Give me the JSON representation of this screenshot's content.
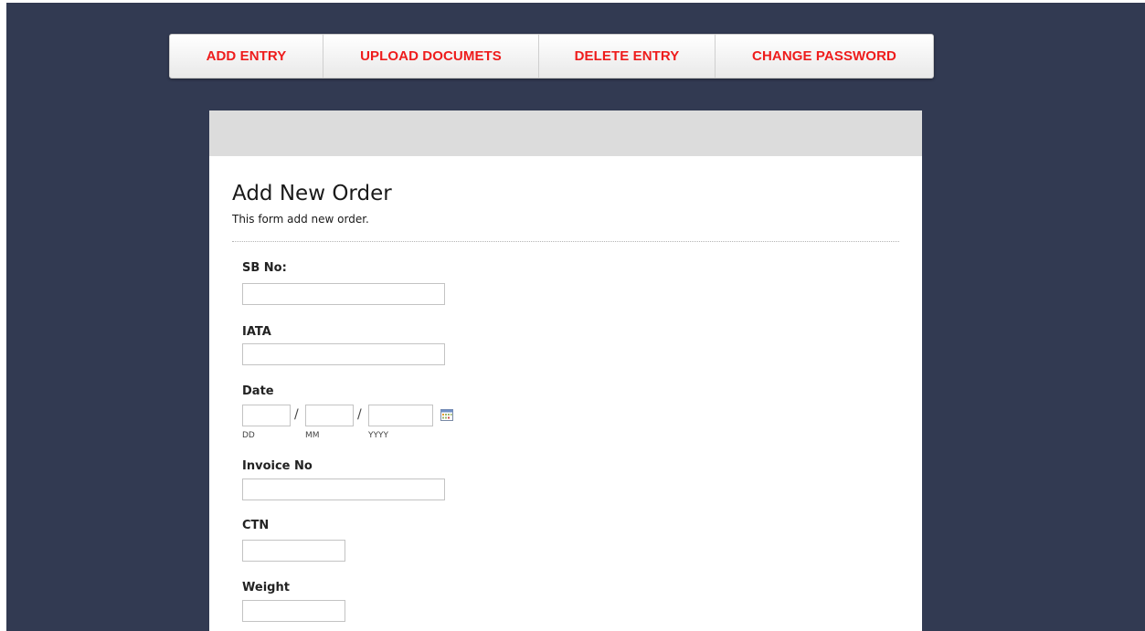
{
  "nav": {
    "items": [
      {
        "label": "ADD ENTRY"
      },
      {
        "label": "UPLOAD DOCUMETS"
      },
      {
        "label": "DELETE ENTRY"
      },
      {
        "label": "CHANGE PASSWORD"
      }
    ]
  },
  "form": {
    "title": "Add New Order",
    "description": "This form add new order.",
    "fields": {
      "sb_no": {
        "label": "SB No:",
        "value": ""
      },
      "iata": {
        "label": "IATA",
        "value": ""
      },
      "date": {
        "label": "Date",
        "day": "",
        "month": "",
        "year": "",
        "day_hint": "DD",
        "month_hint": "MM",
        "year_hint": "YYYY",
        "separator": "/"
      },
      "invoice_no": {
        "label": "Invoice No",
        "value": ""
      },
      "ctn": {
        "label": "CTN",
        "value": ""
      },
      "weight": {
        "label": "Weight",
        "value": ""
      }
    }
  },
  "colors": {
    "background": "#323a52",
    "nav_text": "#ee1c1c",
    "panel_header": "#dcdcdc"
  },
  "icons": {
    "calendar": "calendar-icon"
  }
}
